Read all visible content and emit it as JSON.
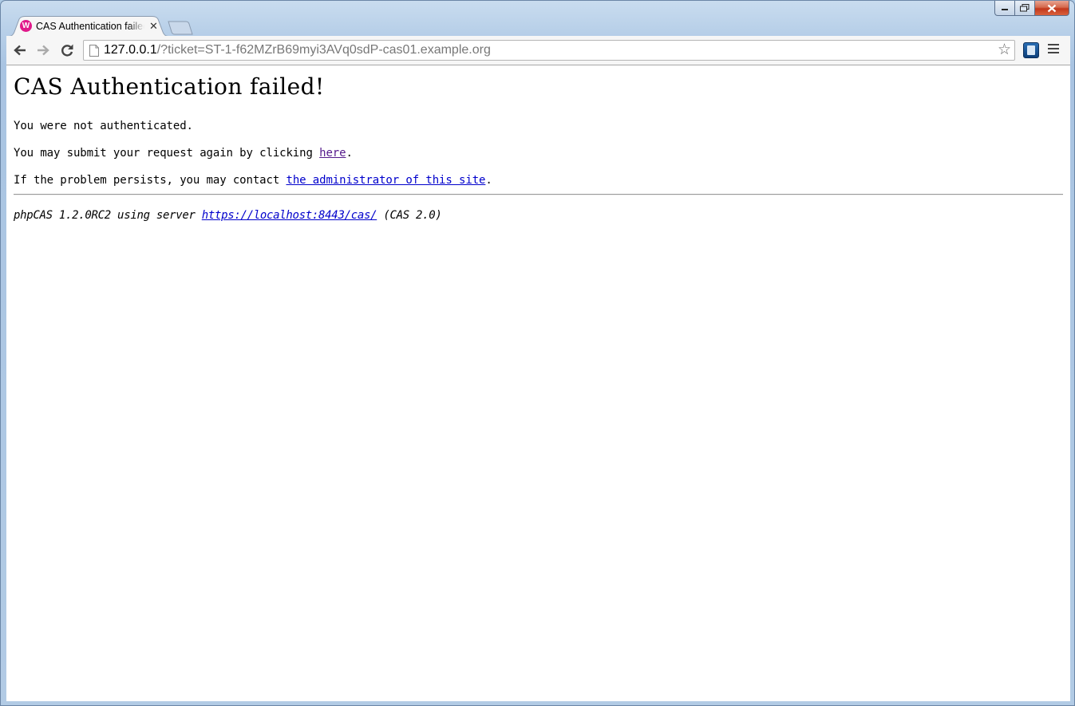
{
  "window": {
    "tab_title": "CAS Authentication failed!",
    "tab_favicon_glyph": "W"
  },
  "toolbar": {
    "url_host": "127.0.0.1",
    "url_rest": "/?ticket=ST-1-f62MZrB69myi3AVq0sdP-cas01.example.org"
  },
  "page": {
    "heading": "CAS Authentication failed!",
    "line1": "You were not authenticated.",
    "line2_prefix": "You may submit your request again by clicking ",
    "line2_link": "here",
    "line2_suffix": ".",
    "line3_prefix": "If the problem persists, you may contact ",
    "line3_link": "the administrator of this site",
    "line3_suffix": ".",
    "footer_prefix": "phpCAS 1.2.0RC2 using server ",
    "footer_link": "https://localhost:8443/cas/",
    "footer_suffix": " (CAS 2.0)"
  },
  "colors": {
    "link": "#0000cc",
    "visited_link": "#551a8b",
    "favicon": "#e0198a"
  }
}
